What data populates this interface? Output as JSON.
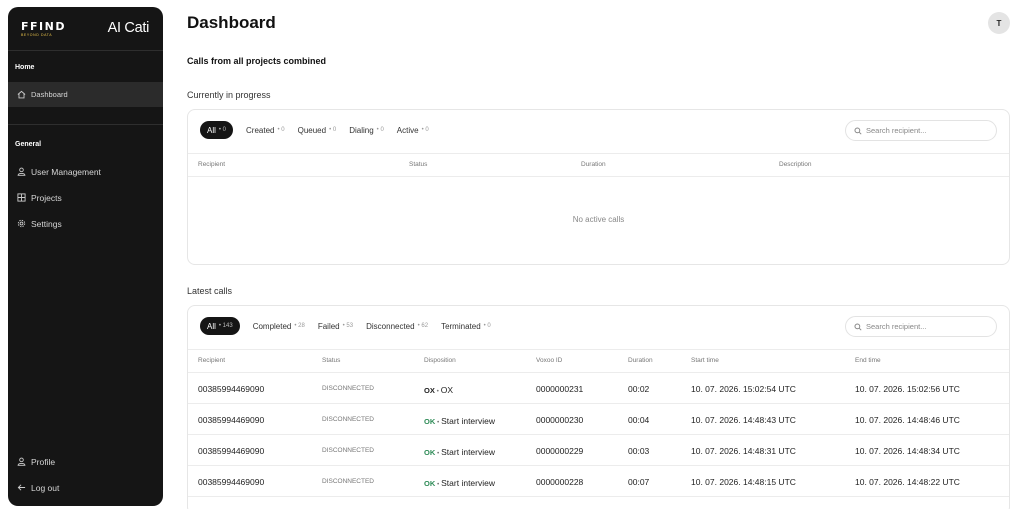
{
  "sidebar": {
    "logo_text": "FFIND",
    "logo_tagline": "BEYOND DATA",
    "app_name": "AI Cati",
    "home_section": "Home",
    "home_items": [
      {
        "label": "Dashboard",
        "icon": "home-icon"
      }
    ],
    "general_section": "General",
    "general_items": [
      {
        "label": "User Management",
        "icon": "user-icon"
      },
      {
        "label": "Projects",
        "icon": "grid-icon"
      },
      {
        "label": "Settings",
        "icon": "gear-icon"
      }
    ],
    "bottom_items": [
      {
        "label": "Profile",
        "icon": "user-icon"
      },
      {
        "label": "Log out",
        "icon": "arrow-left-icon"
      }
    ]
  },
  "header": {
    "title": "Dashboard",
    "avatar_initial": "T"
  },
  "main": {
    "subtitle": "Calls from all projects combined",
    "in_progress": {
      "label": "Currently in progress",
      "tabs": [
        {
          "label": "All",
          "count": "0"
        },
        {
          "label": "Created",
          "count": "0"
        },
        {
          "label": "Queued",
          "count": "0"
        },
        {
          "label": "Dialing",
          "count": "0"
        },
        {
          "label": "Active",
          "count": "0"
        }
      ],
      "search_placeholder": "Search recipient...",
      "columns": [
        "Recipient",
        "Status",
        "Duration",
        "Description"
      ],
      "empty_text": "No active calls"
    },
    "latest": {
      "label": "Latest calls",
      "tabs": [
        {
          "label": "All",
          "count": "143"
        },
        {
          "label": "Completed",
          "count": "28"
        },
        {
          "label": "Failed",
          "count": "53"
        },
        {
          "label": "Disconnected",
          "count": "62"
        },
        {
          "label": "Terminated",
          "count": "0"
        }
      ],
      "search_placeholder": "Search recipient...",
      "columns": [
        "Recipient",
        "Status",
        "Disposition",
        "Voxoo ID",
        "Duration",
        "Start time",
        "End time"
      ],
      "rows": [
        {
          "recipient": "00385994469090",
          "status": "DISCONNECTED",
          "disp_code": "OX",
          "disp_text": "OX",
          "voxoo_id": "0000000231",
          "duration": "00:02",
          "start": "10. 07. 2026. 15:02:54 UTC",
          "end": "10. 07. 2026. 15:02:56 UTC"
        },
        {
          "recipient": "00385994469090",
          "status": "DISCONNECTED",
          "disp_code": "OK",
          "disp_text": "Start interview",
          "voxoo_id": "0000000230",
          "duration": "00:04",
          "start": "10. 07. 2026. 14:48:43 UTC",
          "end": "10. 07. 2026. 14:48:46 UTC"
        },
        {
          "recipient": "00385994469090",
          "status": "DISCONNECTED",
          "disp_code": "OK",
          "disp_text": "Start interview",
          "voxoo_id": "0000000229",
          "duration": "00:03",
          "start": "10. 07. 2026. 14:48:31 UTC",
          "end": "10. 07. 2026. 14:48:34 UTC"
        },
        {
          "recipient": "00385994469090",
          "status": "DISCONNECTED",
          "disp_code": "OK",
          "disp_text": "Start interview",
          "voxoo_id": "0000000228",
          "duration": "00:07",
          "start": "10. 07. 2026. 14:48:15 UTC",
          "end": "10. 07. 2026. 14:48:22 UTC"
        }
      ]
    }
  },
  "colors": {
    "sidebar_bg": "#151515",
    "accent_gold": "#e8c24a",
    "ok_green": "#2e8b57"
  }
}
